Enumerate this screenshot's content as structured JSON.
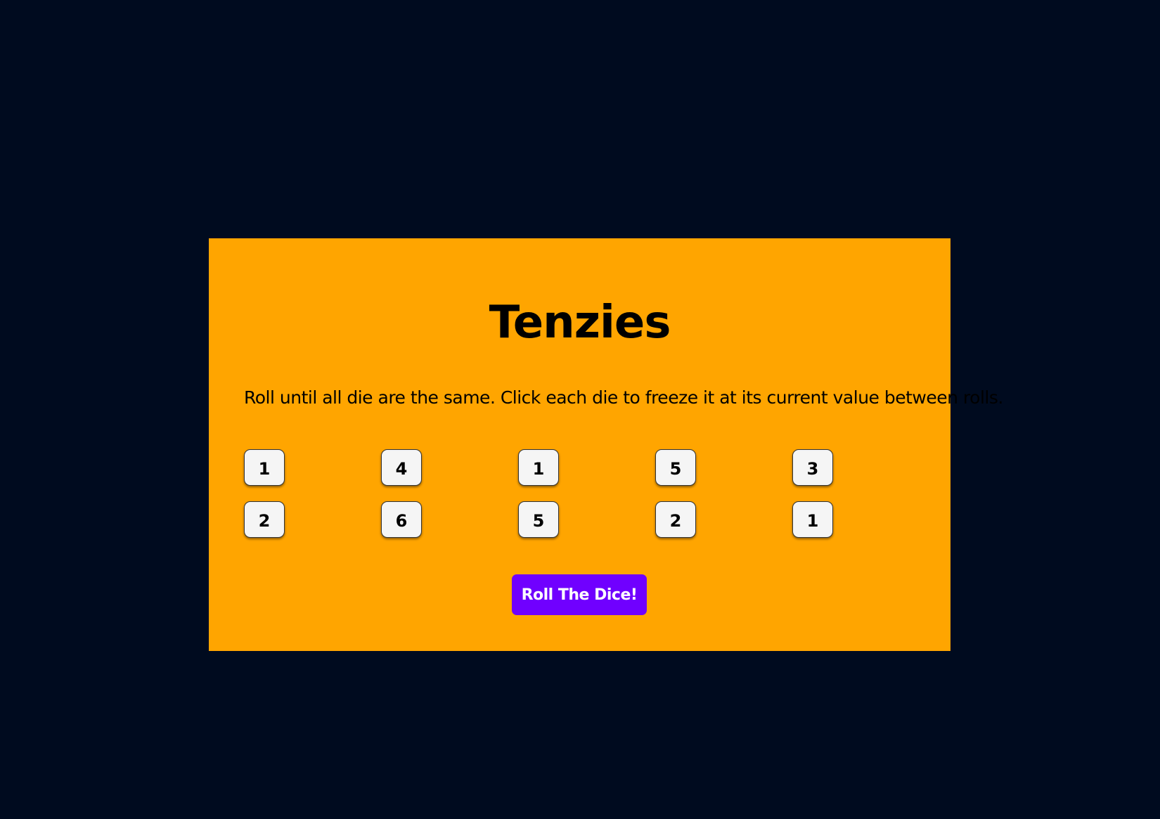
{
  "game": {
    "title": "Tenzies",
    "instructions": "Roll until all die are the same. Click each die to freeze it at its current value between rolls.",
    "dice": [
      {
        "value": "1",
        "held": false
      },
      {
        "value": "4",
        "held": false
      },
      {
        "value": "1",
        "held": false
      },
      {
        "value": "5",
        "held": false
      },
      {
        "value": "3",
        "held": false
      },
      {
        "value": "2",
        "held": false
      },
      {
        "value": "6",
        "held": false
      },
      {
        "value": "5",
        "held": false
      },
      {
        "value": "2",
        "held": false
      },
      {
        "value": "1",
        "held": false
      }
    ],
    "roll_button_label": "Roll The Dice!"
  },
  "colors": {
    "page_background": "#000b1f",
    "board_background": "#ffa500",
    "die_background": "#f5f5f5",
    "button_background": "#7000ff",
    "button_text": "#ffffff"
  }
}
